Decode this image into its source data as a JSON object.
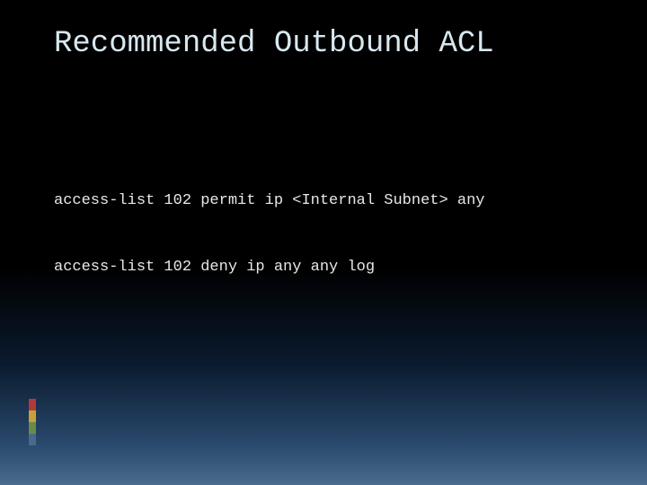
{
  "slide": {
    "title": "Recommended Outbound ACL",
    "lines": [
      "access-list 102 permit ip <Internal Subnet> any",
      "access-list 102 deny ip any any log"
    ]
  },
  "accent_colors": [
    "#b03a3a",
    "#c8a038",
    "#6a8a4a",
    "#486a8a"
  ]
}
